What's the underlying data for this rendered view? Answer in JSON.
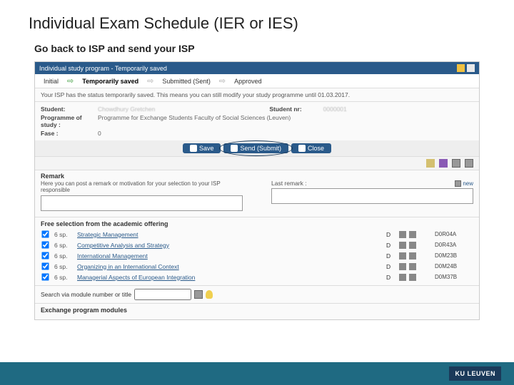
{
  "slide": {
    "title": "Individual Exam Schedule (IER or IES)",
    "subtitle": "Go back to ISP and send your ISP"
  },
  "app": {
    "titlebar": "Individual study program  -  Temporarily saved",
    "stepper": [
      "Initial",
      "Temporarily saved",
      "Submitted (Sent)",
      "Approved"
    ],
    "stepper_current_index": 1,
    "status_line": "Your ISP has the status temporarily saved. This means you can still modify your study programme until 01.03.2017.",
    "info": {
      "student_label": "Student:",
      "student_name": "Chowdhury Gretchen",
      "student_nr_label": "Student nr:",
      "student_nr": "0000001",
      "programme_label": "Programme of study :",
      "programme": "Programme for Exchange Students Faculty of Social Sciences (Leuven)",
      "fase_label": "Fase :",
      "fase": "0"
    },
    "buttons": {
      "save": "Save",
      "send": "Send (Submit)",
      "close": "Close"
    },
    "remark": {
      "label": "Remark",
      "desc": "Here you can post a remark or motivation for your selection to your ISP responsible",
      "last_label": "Last remark :",
      "new_link": "new"
    },
    "free_selection": {
      "header": "Free selection from the academic offering",
      "courses": [
        {
          "sp": "6 sp.",
          "name": "Strategic Management",
          "d": "D",
          "code": "D0R04A"
        },
        {
          "sp": "6 sp.",
          "name": "Competitive Analysis and Strategy",
          "d": "D",
          "code": "D0R43A"
        },
        {
          "sp": "6 sp.",
          "name": "International Management",
          "d": "D",
          "code": "D0M23B"
        },
        {
          "sp": "6 sp.",
          "name": "Organizing in an International Context",
          "d": "D",
          "code": "D0M24B"
        },
        {
          "sp": "6 sp.",
          "name": "Managerial Aspects of European Integration",
          "d": "D",
          "code": "D0M37B"
        }
      ]
    },
    "search": {
      "label": "Search via module number or title",
      "value": ""
    },
    "exchange_header": "Exchange program modules"
  },
  "footer": {
    "badge": "KU LEUVEN"
  }
}
